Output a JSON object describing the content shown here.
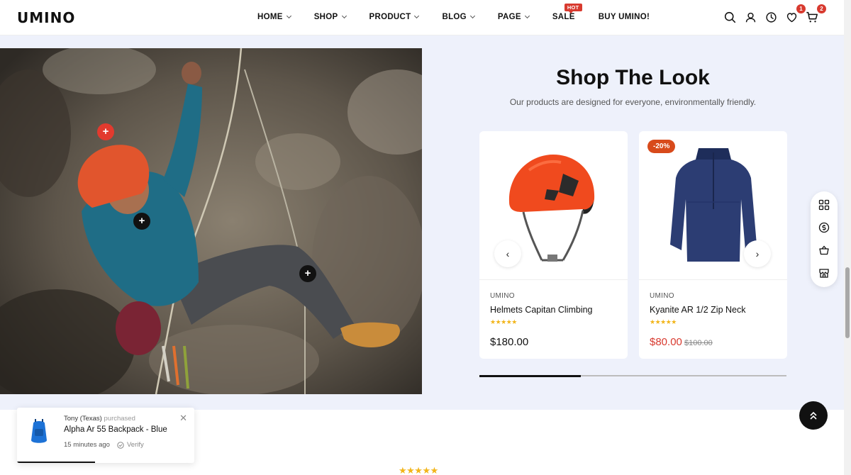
{
  "header": {
    "logo": "UMINO",
    "nav": [
      {
        "label": "HOME",
        "dropdown": true
      },
      {
        "label": "SHOP",
        "dropdown": true
      },
      {
        "label": "PRODUCT",
        "dropdown": true
      },
      {
        "label": "BLOG",
        "dropdown": true
      },
      {
        "label": "PAGE",
        "dropdown": true
      },
      {
        "label": "SALE",
        "dropdown": false,
        "badge": "HOT"
      },
      {
        "label": "BUY UMINO!",
        "dropdown": false
      }
    ],
    "icons": [
      "search-icon",
      "user-icon",
      "clock-icon",
      "heart-icon",
      "cart-icon"
    ],
    "wishlist_count": "1",
    "cart_count": "2"
  },
  "section": {
    "title": "Shop The Look",
    "subtitle": "Our products are designed for everyone, environmentally friendly.",
    "hotspots": [
      "+",
      "+",
      "+"
    ],
    "slider_progress": 0.33
  },
  "products": [
    {
      "brand": "UMINO",
      "name": "Helmets Capitan Climbing",
      "stars": "★★★★★",
      "price": "$180.00",
      "old_price": "",
      "discount": ""
    },
    {
      "brand": "UMINO",
      "name": "Kyanite AR 1/2 Zip Neck",
      "stars": "★★★★★",
      "price": "$80.00",
      "old_price": "$100.00",
      "discount": "-20%"
    }
  ],
  "float_panel": [
    "grid-icon",
    "dollar-icon",
    "basket-icon",
    "store-icon"
  ],
  "toast": {
    "name": "Tony (Texas)",
    "action": "purchased",
    "product": "Alpha Ar 55 Backpack - Blue",
    "time": "15 minutes ago",
    "verify": "Verify"
  },
  "bottom_stars": "★★★★★",
  "colors": {
    "accent_red": "#d83a2f",
    "section_bg": "#eef1fb",
    "star": "#f2b51a"
  }
}
